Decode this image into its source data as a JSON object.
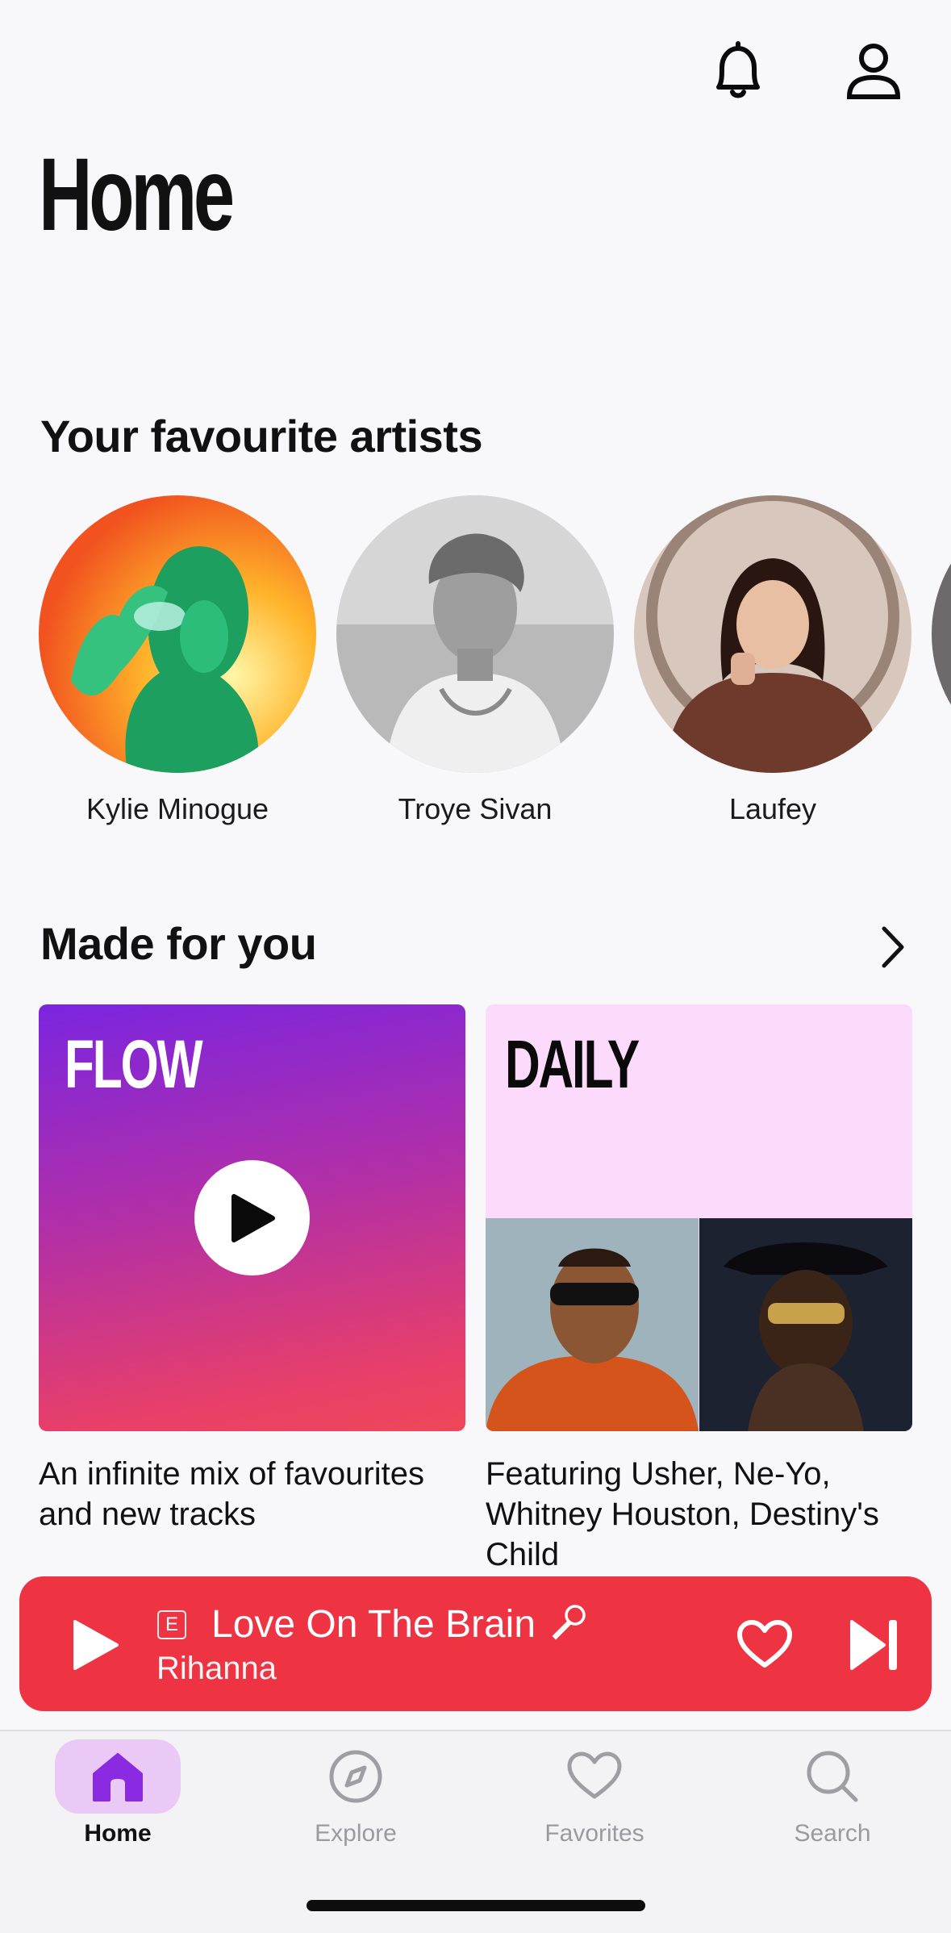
{
  "header": {
    "notifications_icon": "bell-icon",
    "profile_icon": "person-icon"
  },
  "page": {
    "title": "Home"
  },
  "favourite_artists": {
    "title": "Your favourite artists",
    "artists": [
      {
        "name": "Kylie Minogue"
      },
      {
        "name": "Troye Sivan"
      },
      {
        "name": "Laufey"
      }
    ]
  },
  "made_for_you": {
    "title": "Made for you",
    "more_icon": "chevron-right-icon",
    "cards": [
      {
        "label": "FLOW",
        "description": "An infinite mix of favourites and new tracks"
      },
      {
        "label": "DAILY",
        "description": "Featuring Usher, Ne-Yo, Whitney Houston, Destiny's Child"
      }
    ]
  },
  "player": {
    "explicit_badge": "E",
    "track_title": "Love On The Brain",
    "artist": "Rihanna",
    "accent_color": "#ee3343"
  },
  "tabs": [
    {
      "label": "Home",
      "icon": "home-icon",
      "active": true
    },
    {
      "label": "Explore",
      "icon": "compass-icon",
      "active": false
    },
    {
      "label": "Favorites",
      "icon": "heart-icon",
      "active": false
    },
    {
      "label": "Search",
      "icon": "search-icon",
      "active": false
    }
  ],
  "colors": {
    "active_tab_pill": "#ebc9f7",
    "active_tab_icon": "#8a2be2"
  }
}
